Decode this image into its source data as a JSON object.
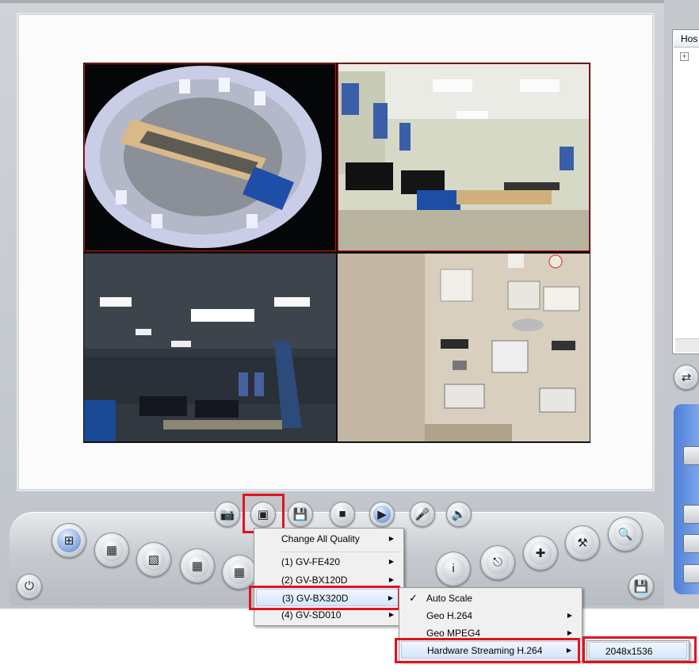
{
  "host_panel": {
    "title": "Hos"
  },
  "menu_cameras": {
    "items": [
      {
        "label": "Change All Quality"
      },
      {
        "label": "(1) GV-FE420"
      },
      {
        "label": "(2) GV-BX120D"
      },
      {
        "label": "(3) GV-BX320D"
      },
      {
        "label": "(4) GV-SD010"
      }
    ]
  },
  "menu_codec": {
    "items": [
      {
        "label": "Auto Scale",
        "checked": true
      },
      {
        "label": "Geo H.264"
      },
      {
        "label": "Geo MPEG4"
      },
      {
        "label": "Hardware Streaming H.264"
      }
    ]
  },
  "menu_resolution": {
    "items": [
      {
        "label": "2048x1536"
      }
    ]
  },
  "icons": {
    "snapshot": "camera-icon",
    "quality": "image-quality-icon",
    "save": "floppy-disk-icon",
    "stop": "stop-icon",
    "play": "play-icon",
    "microphone": "microphone-icon",
    "speaker": "speaker-icon",
    "power": "power-icon"
  },
  "colors": {
    "highlight": "#e3121c",
    "menu_selected": "#d5e6fb",
    "side_panel": "#5f8ee0"
  }
}
